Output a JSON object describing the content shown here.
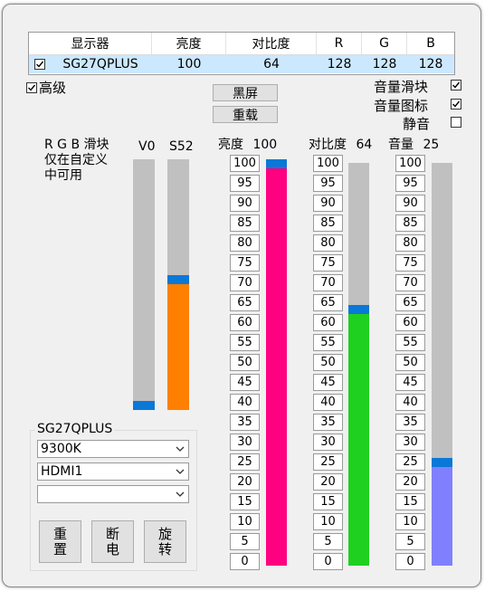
{
  "table": {
    "headers": [
      "显示器",
      "亮度",
      "对比度",
      "R",
      "G",
      "B"
    ],
    "row": {
      "checked": true,
      "cells": [
        "SG27QPLUS",
        "100",
        "64",
        "128",
        "128",
        "128"
      ]
    }
  },
  "advanced": {
    "label": "高级",
    "checked": true
  },
  "buttons": {
    "black_screen": "黑屏",
    "reload": "重载"
  },
  "options": [
    {
      "label": "音量滑块",
      "checked": true
    },
    {
      "label": "音量图标",
      "checked": true
    },
    {
      "label": "静音",
      "checked": false
    }
  ],
  "rgb_note": {
    "title": "R G B 滑块",
    "line1": "仅在自定义",
    "line2": "中可用"
  },
  "sliders": {
    "v": {
      "label": "V0",
      "value": 0,
      "color": "#c0c0c0"
    },
    "s": {
      "label": "S52",
      "value": 52,
      "color": "#ff8000"
    },
    "brightness": {
      "label": "亮度",
      "value_text": "100",
      "value": 100,
      "color": "#ff0080"
    },
    "contrast": {
      "label": "对比度",
      "value_text": "64",
      "value": 64,
      "color": "#20d020"
    },
    "volume": {
      "label": "音量",
      "value_text": "25",
      "value": 25,
      "color": "#8080ff"
    }
  },
  "ticks": [
    "100",
    "95",
    "90",
    "85",
    "80",
    "75",
    "70",
    "65",
    "60",
    "55",
    "50",
    "45",
    "40",
    "35",
    "30",
    "25",
    "20",
    "15",
    "10",
    "5",
    "0"
  ],
  "group": {
    "title": "SG27QPLUS",
    "color_preset": "9300K",
    "input_source": "HDMI1",
    "third": ""
  },
  "actions": {
    "reset": [
      "重",
      "置"
    ],
    "disconnect": [
      "断",
      "电"
    ],
    "rotate": [
      "旋",
      "转"
    ]
  },
  "colors": {
    "thumb": "#0a78d7",
    "track": "#c0c0c0",
    "selection": "#cce8ff"
  }
}
